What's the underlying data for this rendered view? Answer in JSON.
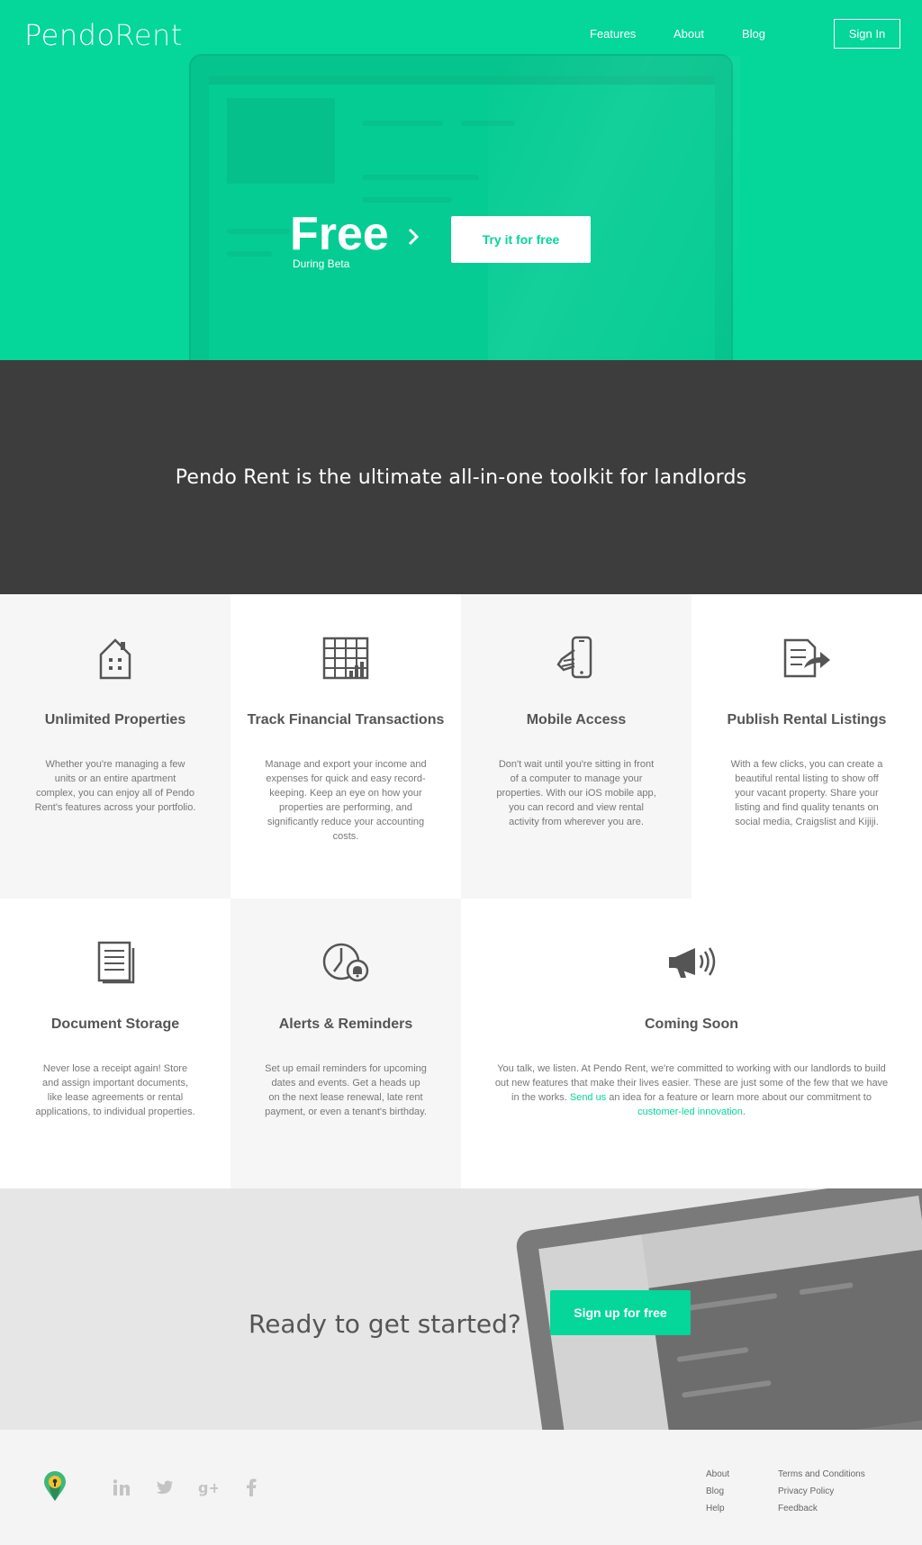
{
  "brand": {
    "name_bold": "Pendo",
    "name_light": "Rent"
  },
  "nav": {
    "features": "Features",
    "about": "About",
    "blog": "Blog",
    "signin": "Sign In"
  },
  "hero": {
    "headline": "Free",
    "sub": "During Beta",
    "cta": "Try it for free",
    "accent": "#05d69a"
  },
  "tagline": "Pendo Rent is the ultimate all-in-one toolkit for landlords",
  "features": [
    {
      "icon": "house-icon",
      "title": "Unlimited Properties",
      "text": "Whether you're managing a few units or an entire apartment complex, you can enjoy all of Pendo Rent's features across your portfolio."
    },
    {
      "icon": "spreadsheet-icon",
      "title": "Track Financial Transactions",
      "text": "Manage and export your income and expenses for quick and easy record-keeping. Keep an eye on how your properties are performing, and significantly reduce your accounting costs."
    },
    {
      "icon": "phone-in-hand-icon",
      "title": "Mobile Access",
      "text": "Don't wait until you're sitting in front of a computer to manage your properties. With our iOS mobile app, you can record and view rental activity from wherever you are."
    },
    {
      "icon": "document-share-icon",
      "title": "Publish Rental Listings",
      "text": "With a few clicks, you can create a beautiful rental listing to show off your vacant property. Share your listing and find quality tenants on social media, Craigslist and Kijiji."
    },
    {
      "icon": "documents-icon",
      "title": "Document Storage",
      "text": "Never lose a receipt again! Store and assign important documents, like lease agreements or rental applications, to individual properties."
    },
    {
      "icon": "clock-bell-icon",
      "title": "Alerts & Reminders",
      "text": "Set up email reminders for upcoming dates and events. Get a heads up on the next lease renewal, late rent payment, or even a tenant's birthday."
    },
    {
      "icon": "megaphone-icon",
      "title": "Coming Soon",
      "text_a": "You talk, we listen. At Pendo Rent, we're committed to working with our landlords to build out new features that make their lives easier. These are just some of the few that we have in the works. ",
      "link_a": "Send us",
      "text_b": " an idea for a feature or learn more about our commitment to ",
      "link_b": "customer-led innovation",
      "text_c": "."
    }
  ],
  "cta": {
    "title": "Ready to get started?",
    "button": "Sign up for free"
  },
  "footer": {
    "social": [
      "linkedin-icon",
      "twitter-icon",
      "google-plus-icon",
      "facebook-icon"
    ],
    "col1": [
      "About",
      "Blog",
      "Help"
    ],
    "col2": [
      "Terms and Conditions",
      "Privacy Policy",
      "Feedback"
    ]
  }
}
